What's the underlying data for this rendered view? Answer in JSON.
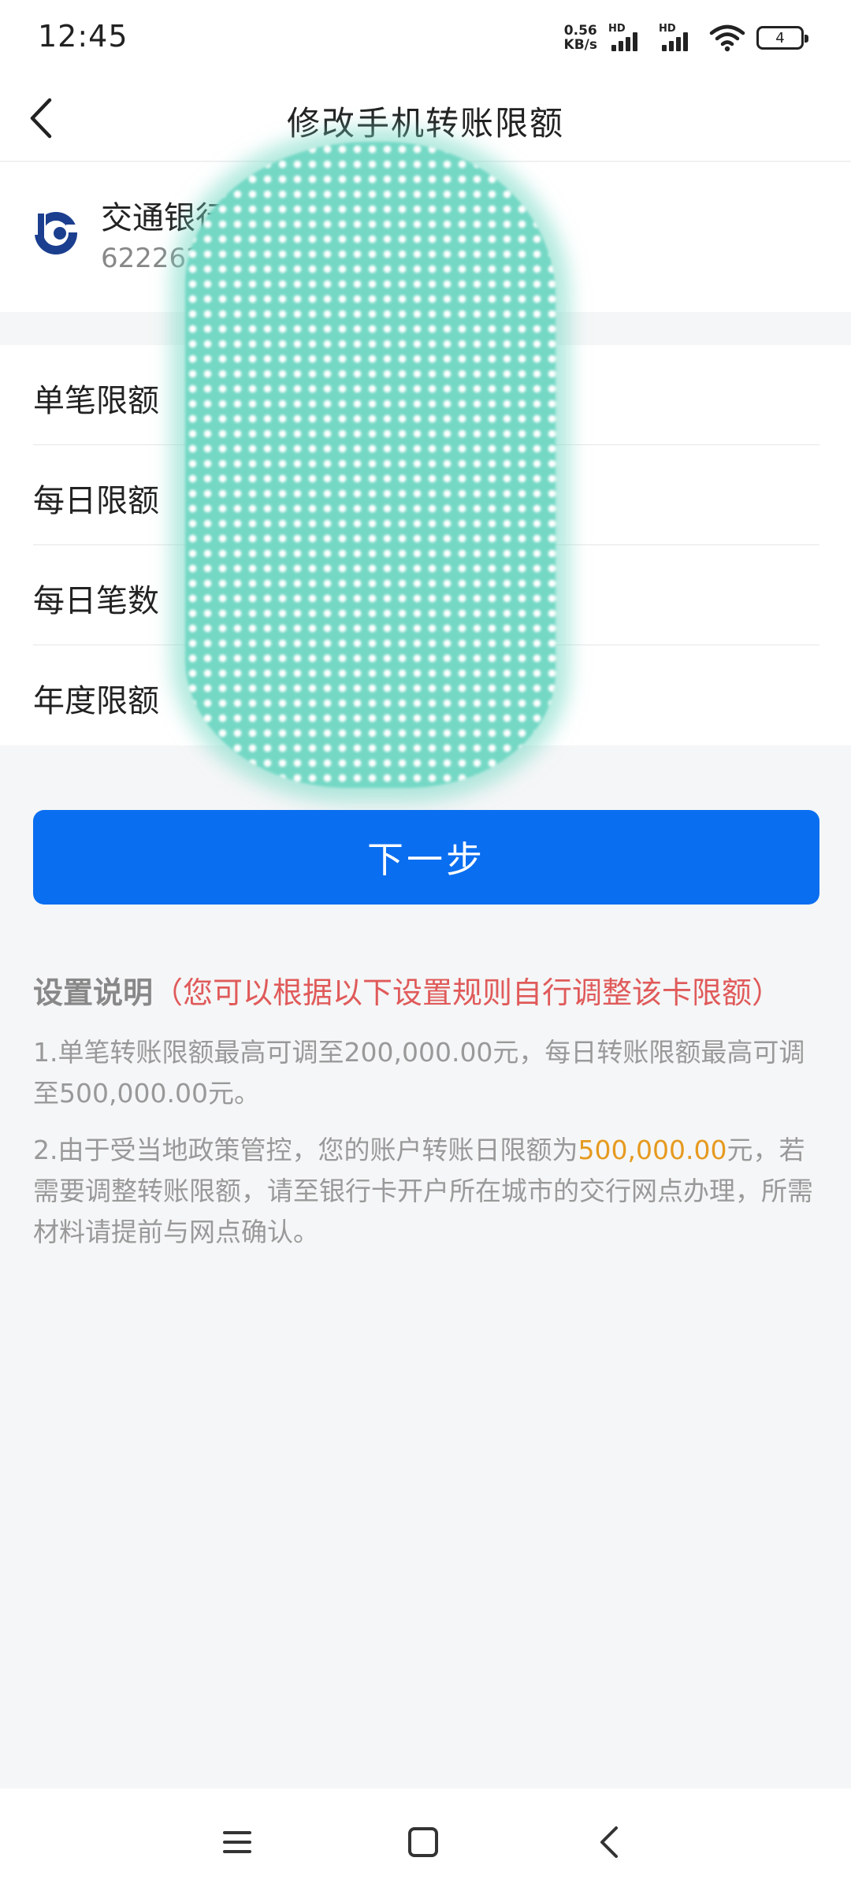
{
  "status_bar": {
    "time": "12:45",
    "net_speed_value": "0.56",
    "net_speed_unit": "KB/s",
    "signal1_label": "HD",
    "signal2_label": "HD",
    "battery_level": "4"
  },
  "header": {
    "title": "修改手机转账限额",
    "back_icon": "chevron-left-icon"
  },
  "card": {
    "bank_name": "交通银行",
    "card_number": "622262**",
    "logo_icon": "bank-of-communications-logo",
    "brand_color": "#1b3f8e"
  },
  "limits": {
    "rows": [
      {
        "label": "单笔限额"
      },
      {
        "label": "每日限额"
      },
      {
        "label": "每日笔数"
      },
      {
        "label": "年度限额"
      }
    ]
  },
  "actions": {
    "next_label": "下一步",
    "accent_color": "#0a6ef0"
  },
  "notes": {
    "heading": "设置说明",
    "hint": "（您可以根据以下设置规则自行调整该卡限额）",
    "item1": "1.单笔转账限额最高可调至200,000.00元，每日转账限额最高可调至500,000.00元。",
    "item2_prefix": "2.由于受当地政策管控，您的账户转账日限额为",
    "item2_amount": "500,000.00",
    "item2_suffix": "元，若需要调整转账限额，请至银行卡开户所在城市的交行网点办理，所需材料请提前与网点确认。"
  },
  "bottom_nav": {
    "menu_icon": "menu-icon",
    "home_icon": "home-square-icon",
    "back_icon": "back-triangle-icon"
  }
}
